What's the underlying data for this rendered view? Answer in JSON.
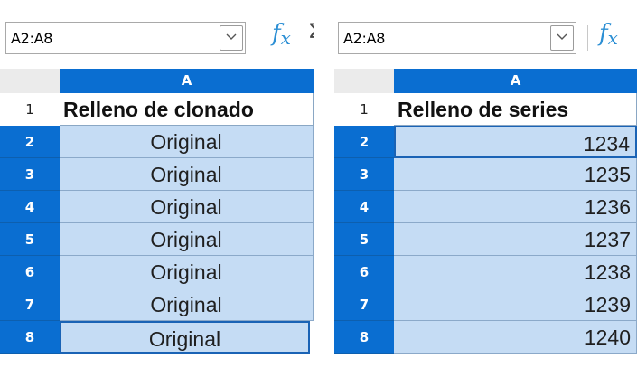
{
  "left_pane": {
    "name_box": "A2:A8",
    "column_header": "A",
    "rows": [
      {
        "row": "1",
        "value": "Relleno de clonado"
      },
      {
        "row": "2",
        "value": "Original"
      },
      {
        "row": "3",
        "value": "Original"
      },
      {
        "row": "4",
        "value": "Original"
      },
      {
        "row": "5",
        "value": "Original"
      },
      {
        "row": "6",
        "value": "Original"
      },
      {
        "row": "7",
        "value": "Original"
      },
      {
        "row": "8",
        "value": "Original"
      }
    ]
  },
  "right_pane": {
    "name_box": "A2:A8",
    "column_header": "A",
    "rows": [
      {
        "row": "1",
        "value": "Relleno de series"
      },
      {
        "row": "2",
        "value": "1234"
      },
      {
        "row": "3",
        "value": "1235"
      },
      {
        "row": "4",
        "value": "1236"
      },
      {
        "row": "5",
        "value": "1237"
      },
      {
        "row": "6",
        "value": "1238"
      },
      {
        "row": "7",
        "value": "1239"
      },
      {
        "row": "8",
        "value": "1240"
      }
    ]
  },
  "icons": {
    "function_wizard": "fx-icon",
    "name_box_dropdown": "chevron-down-icon"
  },
  "colors": {
    "selection_header": "#0a6ed1",
    "selection_fill": "#c5dcf4",
    "fx_icon": "#2c8fd4"
  }
}
